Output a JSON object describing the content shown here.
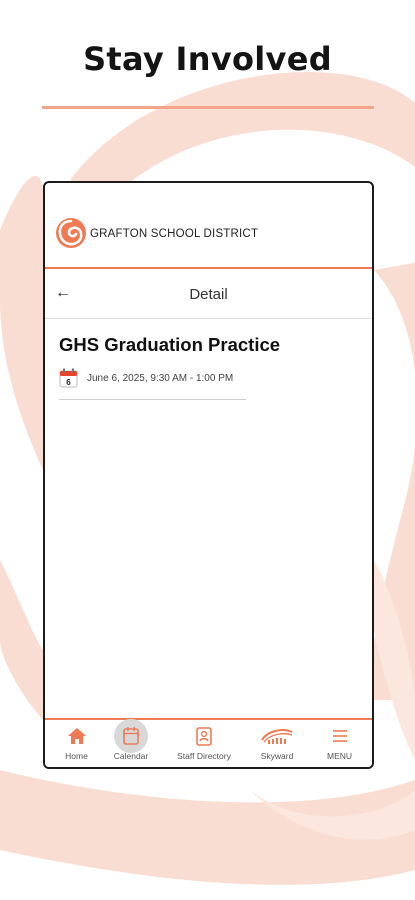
{
  "promo": {
    "headline": "Stay Involved"
  },
  "app": {
    "district_name": "GRAFTON SCHOOL DISTRICT",
    "header_title": "Detail",
    "event": {
      "title": "GHS Graduation Practice",
      "date_text": "June 6, 2025, 9:30 AM - 1:00 PM",
      "calendar_day": "6"
    },
    "tabs": [
      {
        "label": "Home",
        "icon": "home-icon",
        "active": false
      },
      {
        "label": "Calendar",
        "icon": "calendar-icon",
        "active": true
      },
      {
        "label": "Staff Directory",
        "icon": "contact-card-icon",
        "active": false
      },
      {
        "label": "Skyward",
        "icon": "skyward-icon",
        "active": false
      },
      {
        "label": "MENU",
        "icon": "hamburger-icon",
        "active": false
      }
    ]
  },
  "colors": {
    "accent": "#ef7a54",
    "swirl": "#f9ddd2",
    "text": "#111111"
  }
}
